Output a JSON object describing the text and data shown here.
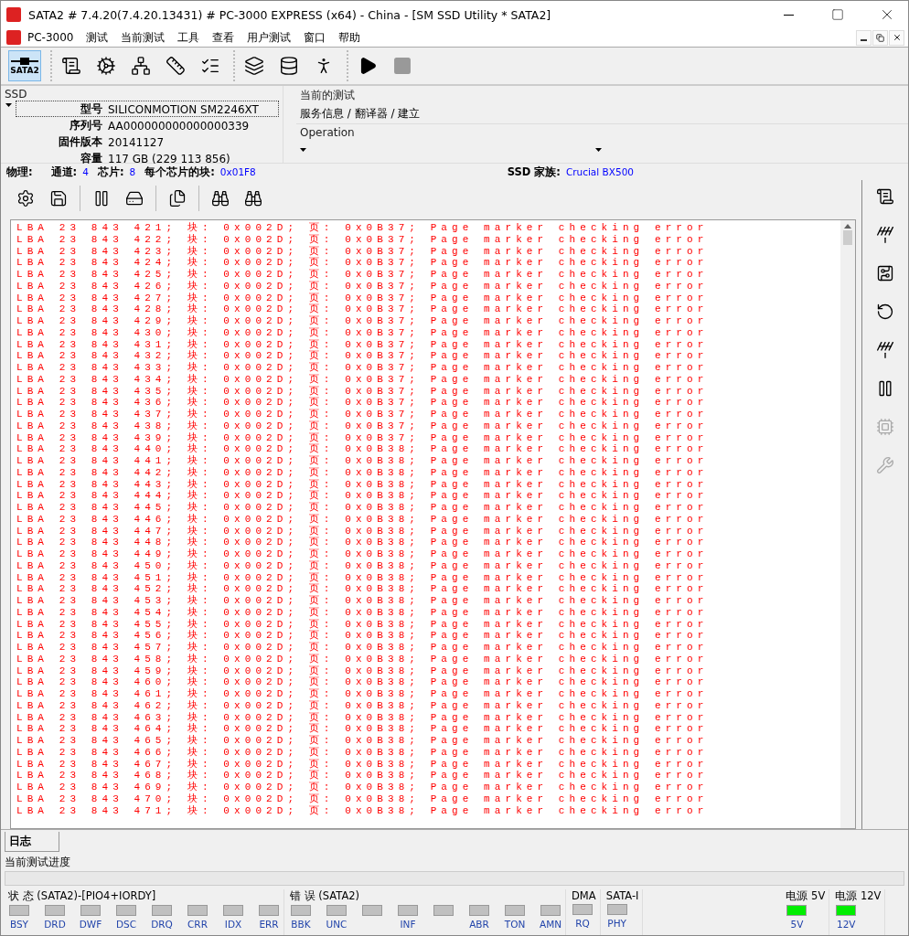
{
  "window": {
    "title": "SATA2 # 7.4.20(7.4.20.13431) # PC-3000 EXPRESS (x64) - China - [SM SSD Utility * SATA2]"
  },
  "menu": [
    "PC-3000",
    "测试",
    "当前测试",
    "工具",
    "查看",
    "用户测试",
    "窗口",
    "帮助"
  ],
  "toolbar": {
    "groups": [
      [
        {
          "label": "SATA2",
          "selected": true,
          "disabled": false
        }
      ],
      [
        {
          "selected": false,
          "disabled": false
        },
        {
          "selected": false,
          "disabled": false
        },
        {
          "selected": false,
          "disabled": false
        },
        {
          "selected": false,
          "disabled": false
        },
        {
          "selected": false,
          "disabled": false
        }
      ],
      [
        {
          "selected": false,
          "disabled": false
        },
        {
          "selected": false,
          "disabled": false
        },
        {
          "selected": false,
          "disabled": false
        }
      ],
      [
        {
          "selected": false,
          "disabled": false
        },
        {
          "selected": false,
          "disabled": true
        }
      ]
    ]
  },
  "ssd": {
    "title": "SSD",
    "fields": [
      {
        "label": "型号",
        "value": "SILICONMOTION SM2246XT"
      },
      {
        "label": "序列号",
        "value": "AA000000000000000339"
      },
      {
        "label": "固件版本",
        "value": "20141127"
      },
      {
        "label": "容量",
        "value": "117 GB (229 113 856)"
      }
    ]
  },
  "current_test": {
    "title": "当前的测试",
    "value": "服务信息 / 翻译器 / 建立"
  },
  "operation": {
    "title": "Operation"
  },
  "physical": {
    "label": "物理:",
    "items": [
      {
        "label": "通道:",
        "value": "4"
      },
      {
        "label": "芯片:",
        "value": "8"
      },
      {
        "label": "每个芯片的块:",
        "value": "0x01F8"
      }
    ],
    "family_label": "SSD 家族:",
    "family_value": "Crucial BX500"
  },
  "log": {
    "lines": [
      "LBA 23 843 421; 块: 0x002D; 页: 0x0B37; Page marker checking error",
      "LBA 23 843 422; 块: 0x002D; 页: 0x0B37; Page marker checking error",
      "LBA 23 843 423; 块: 0x002D; 页: 0x0B37; Page marker checking error",
      "LBA 23 843 424; 块: 0x002D; 页: 0x0B37; Page marker checking error",
      "LBA 23 843 425; 块: 0x002D; 页: 0x0B37; Page marker checking error",
      "LBA 23 843 426; 块: 0x002D; 页: 0x0B37; Page marker checking error",
      "LBA 23 843 427; 块: 0x002D; 页: 0x0B37; Page marker checking error",
      "LBA 23 843 428; 块: 0x002D; 页: 0x0B37; Page marker checking error",
      "LBA 23 843 429; 块: 0x002D; 页: 0x0B37; Page marker checking error",
      "LBA 23 843 430; 块: 0x002D; 页: 0x0B37; Page marker checking error",
      "LBA 23 843 431; 块: 0x002D; 页: 0x0B37; Page marker checking error",
      "LBA 23 843 432; 块: 0x002D; 页: 0x0B37; Page marker checking error",
      "LBA 23 843 433; 块: 0x002D; 页: 0x0B37; Page marker checking error",
      "LBA 23 843 434; 块: 0x002D; 页: 0x0B37; Page marker checking error",
      "LBA 23 843 435; 块: 0x002D; 页: 0x0B37; Page marker checking error",
      "LBA 23 843 436; 块: 0x002D; 页: 0x0B37; Page marker checking error",
      "LBA 23 843 437; 块: 0x002D; 页: 0x0B37; Page marker checking error",
      "LBA 23 843 438; 块: 0x002D; 页: 0x0B37; Page marker checking error",
      "LBA 23 843 439; 块: 0x002D; 页: 0x0B37; Page marker checking error",
      "LBA 23 843 440; 块: 0x002D; 页: 0x0B38; Page marker checking error",
      "LBA 23 843 441; 块: 0x002D; 页: 0x0B38; Page marker checking error",
      "LBA 23 843 442; 块: 0x002D; 页: 0x0B38; Page marker checking error",
      "LBA 23 843 443; 块: 0x002D; 页: 0x0B38; Page marker checking error",
      "LBA 23 843 444; 块: 0x002D; 页: 0x0B38; Page marker checking error",
      "LBA 23 843 445; 块: 0x002D; 页: 0x0B38; Page marker checking error",
      "LBA 23 843 446; 块: 0x002D; 页: 0x0B38; Page marker checking error",
      "LBA 23 843 447; 块: 0x002D; 页: 0x0B38; Page marker checking error",
      "LBA 23 843 448; 块: 0x002D; 页: 0x0B38; Page marker checking error",
      "LBA 23 843 449; 块: 0x002D; 页: 0x0B38; Page marker checking error",
      "LBA 23 843 450; 块: 0x002D; 页: 0x0B38; Page marker checking error",
      "LBA 23 843 451; 块: 0x002D; 页: 0x0B38; Page marker checking error",
      "LBA 23 843 452; 块: 0x002D; 页: 0x0B38; Page marker checking error",
      "LBA 23 843 453; 块: 0x002D; 页: 0x0B38; Page marker checking error",
      "LBA 23 843 454; 块: 0x002D; 页: 0x0B38; Page marker checking error",
      "LBA 23 843 455; 块: 0x002D; 页: 0x0B38; Page marker checking error",
      "LBA 23 843 456; 块: 0x002D; 页: 0x0B38; Page marker checking error",
      "LBA 23 843 457; 块: 0x002D; 页: 0x0B38; Page marker checking error",
      "LBA 23 843 458; 块: 0x002D; 页: 0x0B38; Page marker checking error",
      "LBA 23 843 459; 块: 0x002D; 页: 0x0B38; Page marker checking error",
      "LBA 23 843 460; 块: 0x002D; 页: 0x0B38; Page marker checking error",
      "LBA 23 843 461; 块: 0x002D; 页: 0x0B38; Page marker checking error",
      "LBA 23 843 462; 块: 0x002D; 页: 0x0B38; Page marker checking error",
      "LBA 23 843 463; 块: 0x002D; 页: 0x0B38; Page marker checking error",
      "LBA 23 843 464; 块: 0x002D; 页: 0x0B38; Page marker checking error",
      "LBA 23 843 465; 块: 0x002D; 页: 0x0B38; Page marker checking error",
      "LBA 23 843 466; 块: 0x002D; 页: 0x0B38; Page marker checking error",
      "LBA 23 843 467; 块: 0x002D; 页: 0x0B38; Page marker checking error",
      "LBA 23 843 468; 块: 0x002D; 页: 0x0B38; Page marker checking error",
      "LBA 23 843 469; 块: 0x002D; 页: 0x0B38; Page marker checking error",
      "LBA 23 843 470; 块: 0x002D; 页: 0x0B38; Page marker checking error",
      "LBA 23 843 471; 块: 0x002D; 页: 0x0B38; Page marker checking error"
    ]
  },
  "sidebar": [
    {
      "disabled": false
    },
    {
      "disabled": false
    },
    {
      "disabled": false
    },
    {
      "disabled": false
    },
    {
      "disabled": false
    },
    {
      "disabled": false
    },
    {
      "disabled": true
    },
    {
      "disabled": true
    }
  ],
  "tabs": [
    {
      "label": "日志",
      "selected": true
    }
  ],
  "progress": {
    "label": "当前测试进度",
    "level": 0
  },
  "status": [
    {
      "title": "状 态 (SATA2)-[PIO4+IORDY]",
      "leds": [
        {
          "label": "BSY",
          "on": false
        },
        {
          "label": "DRD",
          "on": false
        },
        {
          "label": "DWF",
          "on": false
        },
        {
          "label": "DSC",
          "on": false
        },
        {
          "label": "DRQ",
          "on": false
        },
        {
          "label": "CRR",
          "on": false
        },
        {
          "label": "IDX",
          "on": false
        },
        {
          "label": "ERR",
          "on": false
        }
      ]
    },
    {
      "title": "错 误 (SATA2)",
      "leds": [
        {
          "label": "BBK",
          "on": false
        },
        {
          "label": "UNC",
          "on": false
        },
        {
          "on": false
        },
        {
          "label": "INF",
          "on": false
        },
        {
          "on": false
        },
        {
          "label": "ABR",
          "on": false
        },
        {
          "label": "TON",
          "on": false
        },
        {
          "label": "AMN",
          "on": false
        }
      ]
    },
    {
      "title": "DMA",
      "leds": [
        {
          "label": "RQ",
          "on": false
        }
      ]
    },
    {
      "title": "SATA-I",
      "leds": [
        {
          "label": "PHY",
          "on": false
        }
      ]
    },
    {
      "title": "电源 5V",
      "leds": [
        {
          "label": "5V",
          "on": true
        }
      ]
    },
    {
      "title": "电源 12V",
      "leds": [
        {
          "label": "12V",
          "on": true
        }
      ]
    }
  ]
}
